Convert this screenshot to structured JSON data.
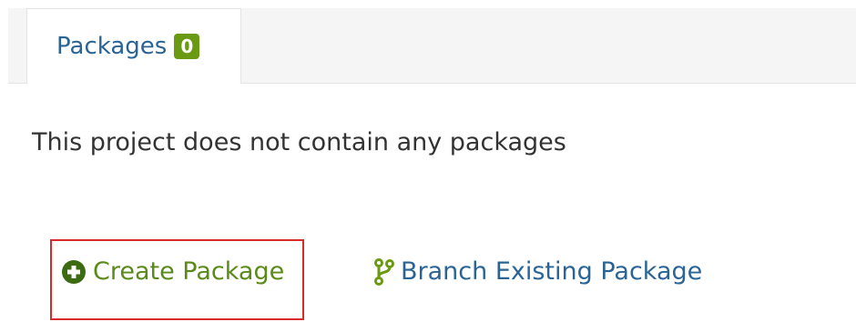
{
  "tabs": [
    {
      "label": "Packages",
      "badge": "0"
    }
  ],
  "main": {
    "empty_message": "This project does not contain any packages"
  },
  "actions": {
    "create_label": "Create Package",
    "create_icon": "plus-circle-icon",
    "branch_label": "Branch Existing Package",
    "branch_icon": "code-branch-icon"
  },
  "colors": {
    "link_blue": "#2a6496",
    "link_green": "#5a8a1a",
    "badge_green": "#6a9a12",
    "highlight_red": "#d92b2b"
  }
}
